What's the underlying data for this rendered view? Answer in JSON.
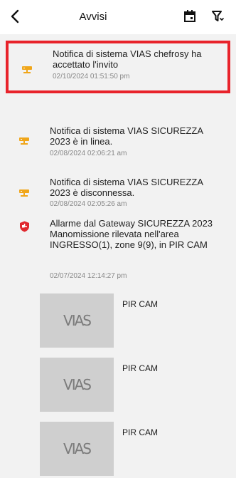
{
  "header": {
    "title": "Avvisi",
    "icons": [
      "back-chevron-icon",
      "calendar-icon",
      "filter-icon"
    ]
  },
  "notifications": [
    {
      "icon": "router-icon",
      "text": "Notifica di sistema VIAS chefrosy ha accettato l'invito",
      "time": "02/10/2024 01:51:50 pm",
      "highlighted": true
    },
    {
      "icon": "router-icon",
      "text": "Notifica di sistema VIAS SICUREZZA 2023 è in linea.",
      "time": "02/08/2024 02:06:21 am"
    },
    {
      "icon": "router-icon",
      "text": "Notifica di sistema VIAS SICUREZZA 2023 è disconnessa.",
      "time": "02/08/2024 02:05:26 am"
    },
    {
      "icon": "shield-alarm-icon",
      "text": "Allarme dal Gateway SICUREZZA 2023 Manomissione rilevata nell'area INGRESSO(1), zone 9(9), in PIR CAM",
      "time": "02/07/2024 12:14:27 pm"
    }
  ],
  "pir_images": [
    {
      "thumb_text": "VIAS",
      "label": "PIR CAM"
    },
    {
      "thumb_text": "VIAS",
      "label": "PIR CAM"
    },
    {
      "thumb_text": "VIAS",
      "label": "PIR CAM"
    }
  ],
  "colors": {
    "highlight_border": "#e8232b",
    "router_icon": "#f0a61a",
    "alarm_icon": "#e0282e"
  }
}
